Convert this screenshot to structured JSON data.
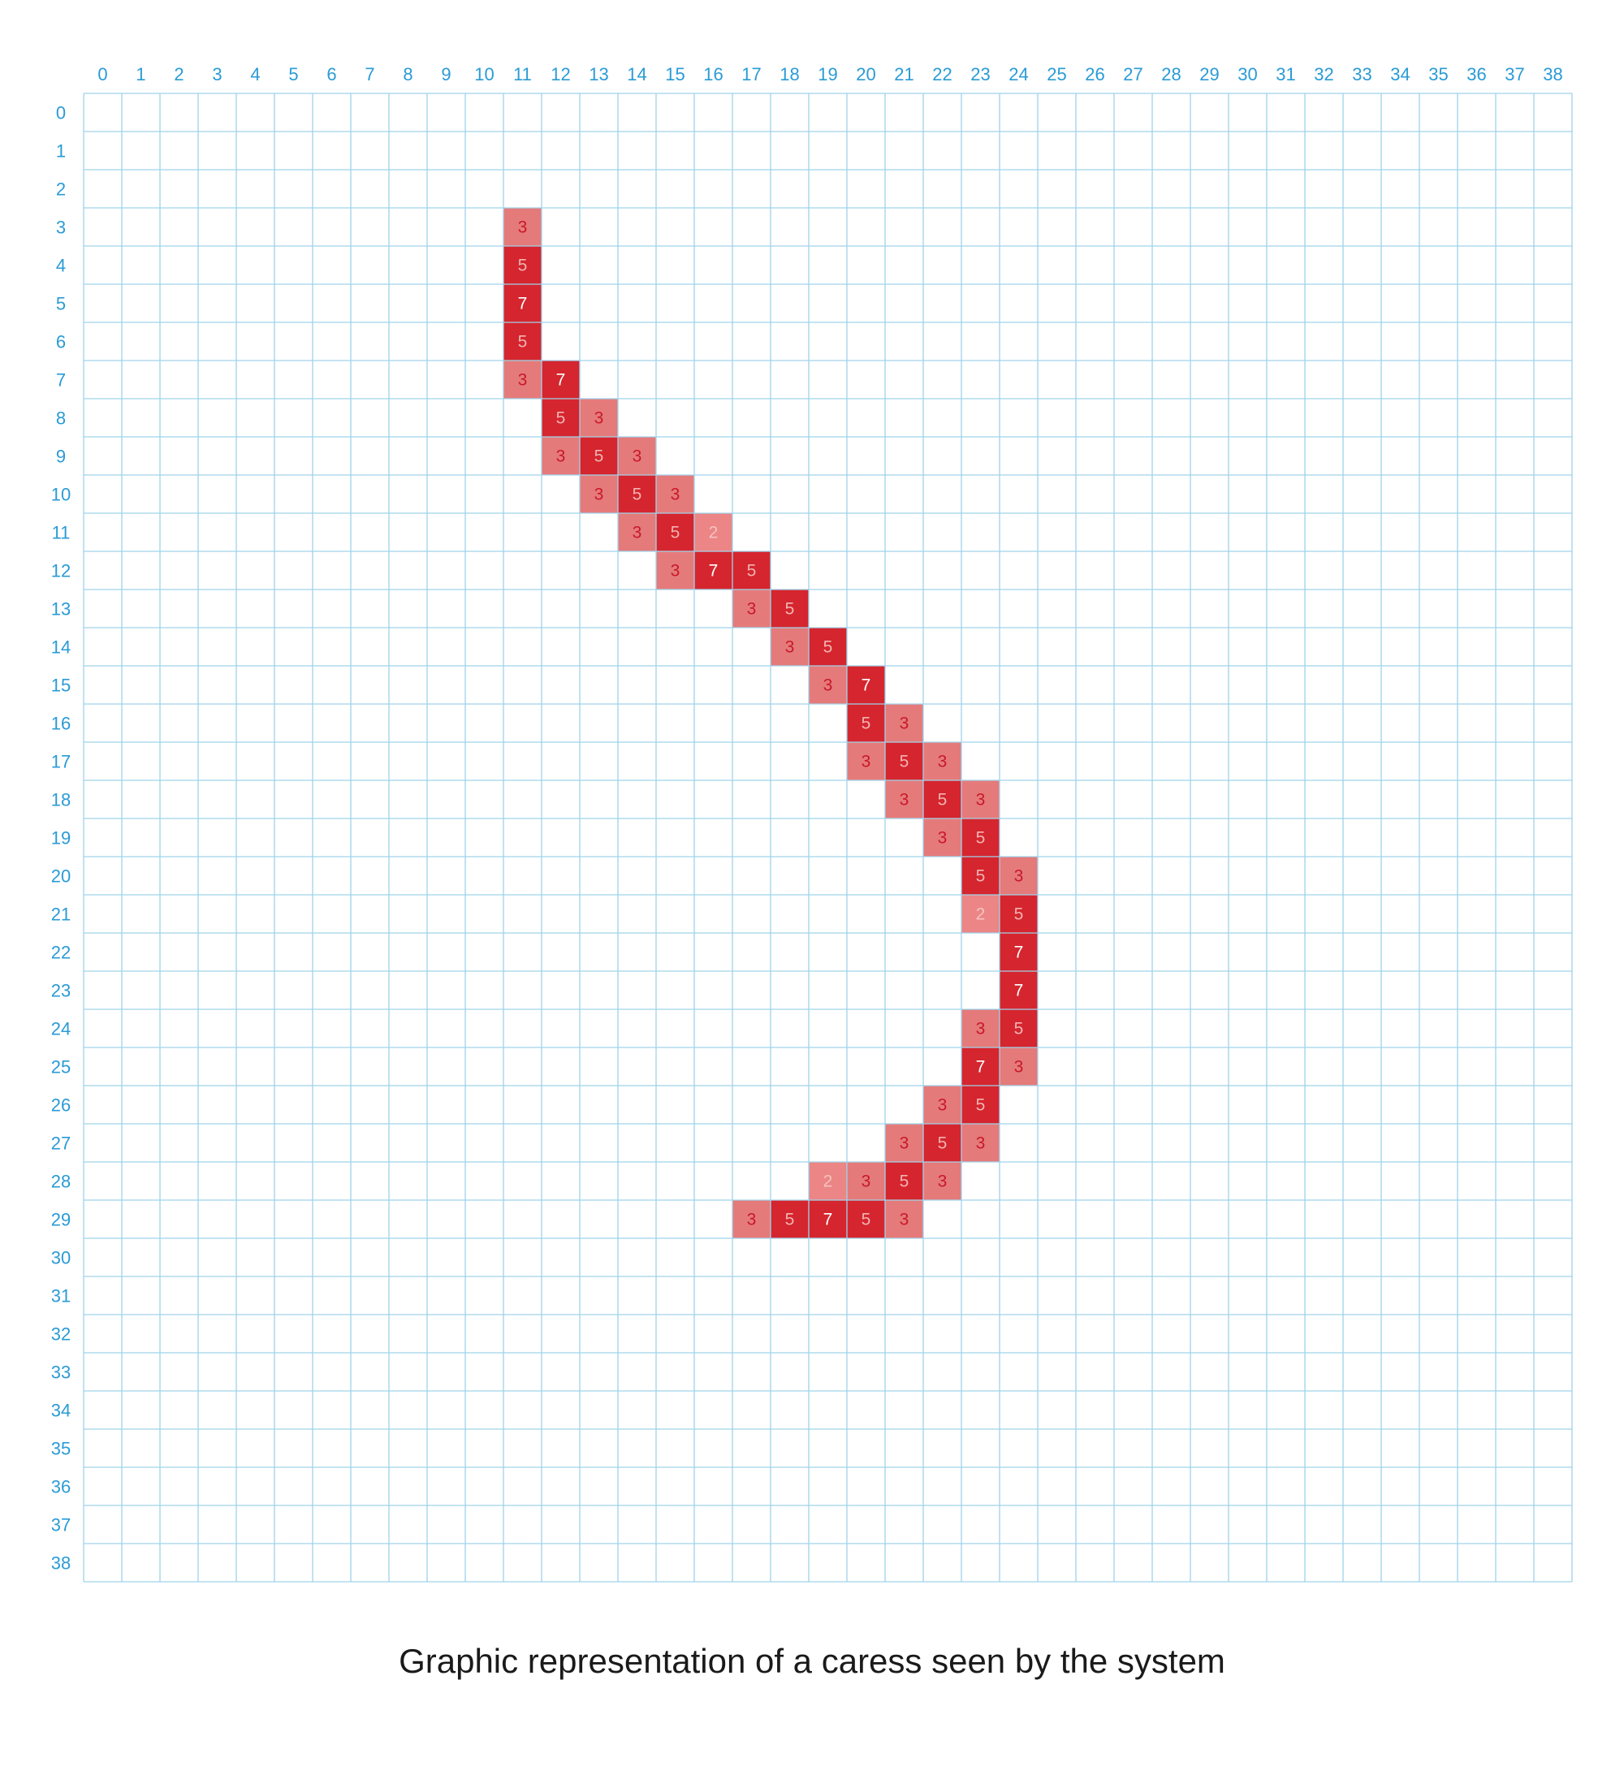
{
  "caption": "Graphic representation of a caress seen by the system",
  "colors": {
    "grid_line": "#9fd3ea",
    "axis_label": "#2a9bd6",
    "level_2_fill": "#ec8585",
    "level_3_fill": "#e57a7a",
    "level_5_fill": "#d5252e",
    "level_7_fill": "#d5252e",
    "text_light": "#ffffff",
    "text_on_light": "#c8182a",
    "text_level_2": "#f6c2c2",
    "text_level_5": "#f3b3b3"
  },
  "chart_data": {
    "type": "heatmap",
    "title": "Graphic representation of a caress seen by the system",
    "x_ticks": [
      0,
      1,
      2,
      3,
      4,
      5,
      6,
      7,
      8,
      9,
      10,
      11,
      12,
      13,
      14,
      15,
      16,
      17,
      18,
      19,
      20,
      21,
      22,
      23,
      24,
      25,
      26,
      27,
      28,
      29,
      30,
      31,
      32,
      33,
      34,
      35,
      36,
      37,
      38
    ],
    "y_ticks": [
      0,
      1,
      2,
      3,
      4,
      5,
      6,
      7,
      8,
      9,
      10,
      11,
      12,
      13,
      14,
      15,
      16,
      17,
      18,
      19,
      20,
      21,
      22,
      23,
      24,
      25,
      26,
      27,
      28,
      29,
      30,
      31,
      32,
      33,
      34,
      35,
      36,
      37,
      38
    ],
    "xlim": [
      0,
      38
    ],
    "ylim": [
      0,
      38
    ],
    "grid": true,
    "cells": [
      {
        "x": 11,
        "y": 3,
        "value": 3
      },
      {
        "x": 11,
        "y": 4,
        "value": 5
      },
      {
        "x": 11,
        "y": 5,
        "value": 7
      },
      {
        "x": 11,
        "y": 6,
        "value": 5
      },
      {
        "x": 11,
        "y": 7,
        "value": 3
      },
      {
        "x": 12,
        "y": 7,
        "value": 7
      },
      {
        "x": 12,
        "y": 8,
        "value": 5
      },
      {
        "x": 13,
        "y": 8,
        "value": 3
      },
      {
        "x": 12,
        "y": 9,
        "value": 3
      },
      {
        "x": 13,
        "y": 9,
        "value": 5
      },
      {
        "x": 14,
        "y": 9,
        "value": 3
      },
      {
        "x": 13,
        "y": 10,
        "value": 3
      },
      {
        "x": 14,
        "y": 10,
        "value": 5
      },
      {
        "x": 15,
        "y": 10,
        "value": 3
      },
      {
        "x": 14,
        "y": 11,
        "value": 3
      },
      {
        "x": 15,
        "y": 11,
        "value": 5
      },
      {
        "x": 16,
        "y": 11,
        "value": 2
      },
      {
        "x": 15,
        "y": 12,
        "value": 3
      },
      {
        "x": 16,
        "y": 12,
        "value": 7
      },
      {
        "x": 17,
        "y": 12,
        "value": 5
      },
      {
        "x": 17,
        "y": 13,
        "value": 3
      },
      {
        "x": 18,
        "y": 13,
        "value": 5
      },
      {
        "x": 18,
        "y": 14,
        "value": 3
      },
      {
        "x": 19,
        "y": 14,
        "value": 5
      },
      {
        "x": 19,
        "y": 15,
        "value": 3
      },
      {
        "x": 20,
        "y": 15,
        "value": 7
      },
      {
        "x": 20,
        "y": 16,
        "value": 5
      },
      {
        "x": 21,
        "y": 16,
        "value": 3
      },
      {
        "x": 20,
        "y": 17,
        "value": 3
      },
      {
        "x": 21,
        "y": 17,
        "value": 5
      },
      {
        "x": 22,
        "y": 17,
        "value": 3
      },
      {
        "x": 21,
        "y": 18,
        "value": 3
      },
      {
        "x": 22,
        "y": 18,
        "value": 5
      },
      {
        "x": 23,
        "y": 18,
        "value": 3
      },
      {
        "x": 22,
        "y": 19,
        "value": 3
      },
      {
        "x": 23,
        "y": 19,
        "value": 5
      },
      {
        "x": 23,
        "y": 20,
        "value": 5
      },
      {
        "x": 24,
        "y": 20,
        "value": 3
      },
      {
        "x": 23,
        "y": 21,
        "value": 2
      },
      {
        "x": 24,
        "y": 21,
        "value": 5
      },
      {
        "x": 24,
        "y": 22,
        "value": 7
      },
      {
        "x": 24,
        "y": 23,
        "value": 7
      },
      {
        "x": 23,
        "y": 24,
        "value": 3
      },
      {
        "x": 24,
        "y": 24,
        "value": 5
      },
      {
        "x": 23,
        "y": 25,
        "value": 7
      },
      {
        "x": 24,
        "y": 25,
        "value": 3
      },
      {
        "x": 22,
        "y": 26,
        "value": 3
      },
      {
        "x": 23,
        "y": 26,
        "value": 5
      },
      {
        "x": 21,
        "y": 27,
        "value": 3
      },
      {
        "x": 22,
        "y": 27,
        "value": 5
      },
      {
        "x": 23,
        "y": 27,
        "value": 3
      },
      {
        "x": 19,
        "y": 28,
        "value": 2
      },
      {
        "x": 20,
        "y": 28,
        "value": 3
      },
      {
        "x": 21,
        "y": 28,
        "value": 5
      },
      {
        "x": 22,
        "y": 28,
        "value": 3
      },
      {
        "x": 17,
        "y": 29,
        "value": 3
      },
      {
        "x": 18,
        "y": 29,
        "value": 5
      },
      {
        "x": 19,
        "y": 29,
        "value": 7
      },
      {
        "x": 20,
        "y": 29,
        "value": 5
      },
      {
        "x": 21,
        "y": 29,
        "value": 3
      }
    ]
  }
}
